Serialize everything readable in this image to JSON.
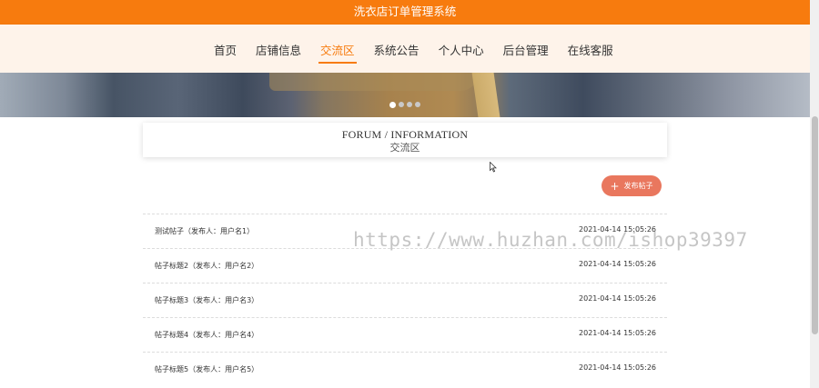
{
  "app": {
    "title": "洗衣店订单管理系统"
  },
  "nav": {
    "items": [
      {
        "label": "首页"
      },
      {
        "label": "店铺信息"
      },
      {
        "label": "交流区"
      },
      {
        "label": "系统公告"
      },
      {
        "label": "个人中心"
      },
      {
        "label": "后台管理"
      },
      {
        "label": "在线客服"
      }
    ],
    "active_index": 2
  },
  "banner": {
    "dot_count": 4,
    "active_dot": 0
  },
  "forum": {
    "title_en": "FORUM / INFORMATION",
    "title_cn": "交流区"
  },
  "post_button": {
    "label": "发布帖子",
    "icon": "plus-icon"
  },
  "posts": [
    {
      "title": "测试帖子（发布人：用户名1）",
      "date": "2021-04-14 15:05:26"
    },
    {
      "title": "帖子标题2（发布人：用户名2）",
      "date": "2021-04-14 15:05:26"
    },
    {
      "title": "帖子标题3（发布人：用户名3）",
      "date": "2021-04-14 15:05:26"
    },
    {
      "title": "帖子标题4（发布人：用户名4）",
      "date": "2021-04-14 15:05:26"
    },
    {
      "title": "帖子标题5（发布人：用户名5）",
      "date": "2021-04-14 15:05:26"
    }
  ],
  "watermark": {
    "text": "https://www.huzhan.com/ishop39397"
  },
  "colors": {
    "primary": "#f77b0e",
    "nav_bg": "#fef3ea",
    "button": "#e9775e"
  }
}
